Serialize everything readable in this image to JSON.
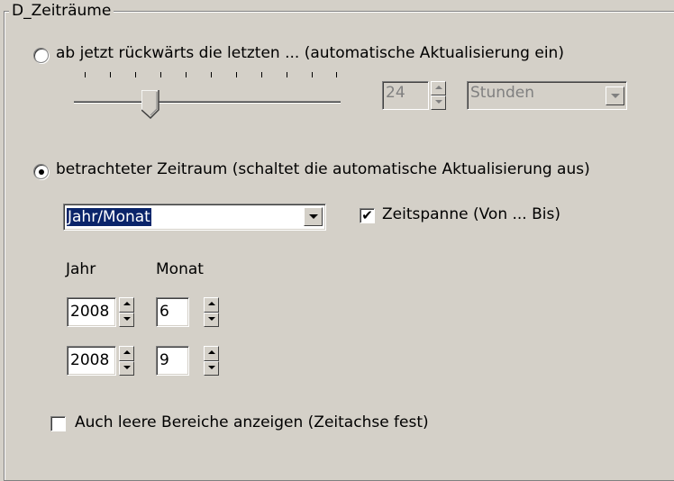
{
  "group": {
    "title": "D_Zeiträume"
  },
  "relative": {
    "radio_label": "ab jetzt rückwärts die letzten ... (automatische Aktualisierung ein)",
    "selected": false,
    "slider_level": 0.27,
    "count_value": "24",
    "unit_value": "Stunden"
  },
  "period": {
    "radio_label": "betrachteter Zeitraum (schaltet die automatische Aktualisierung aus)",
    "selected": true,
    "mode_value": "Jahr/Monat",
    "span_checkbox_label": "Zeitspanne (Von ... Bis)",
    "span_checked": true,
    "col_year": "Jahr",
    "col_month": "Monat",
    "from_year": "2008",
    "from_month": "6",
    "to_year": "2008",
    "to_month": "9"
  },
  "empty_ranges": {
    "label": "Auch leere Bereiche anzeigen (Zeitachse fest)",
    "checked": false
  }
}
